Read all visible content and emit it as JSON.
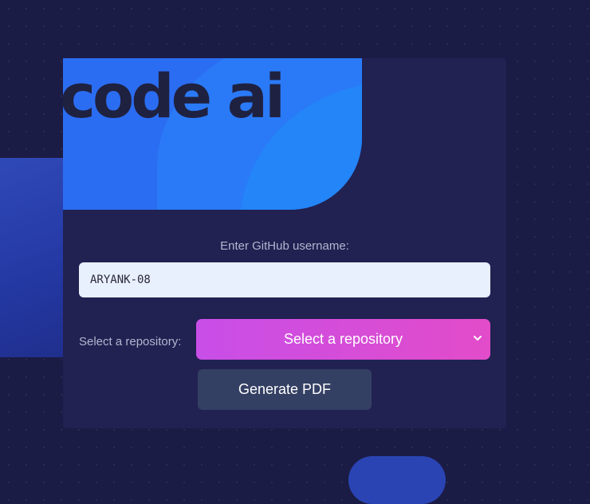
{
  "brand": {
    "logo_text": "code ai"
  },
  "form": {
    "username_label": "Enter GitHub username:",
    "username_value": "ARYANK-08",
    "repo_label": "Select a repository:",
    "repo_selected": "Select a repository",
    "generate_label": "Generate PDF"
  },
  "icons": {
    "repo_dropdown": "chevron-down-icon"
  },
  "colors": {
    "background": "#1b1c45",
    "card": "#212152",
    "banner": "#2b6df2",
    "select_gradient_start": "#c84ee8",
    "select_gradient_end": "#e24cc9",
    "button": "#344063"
  }
}
